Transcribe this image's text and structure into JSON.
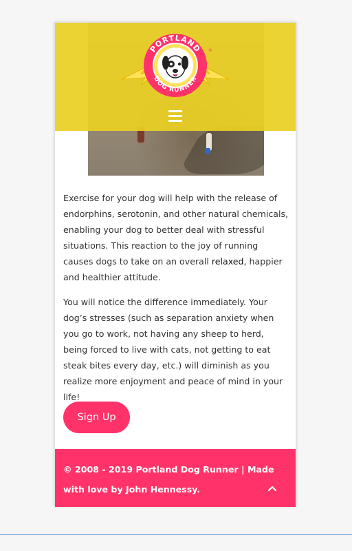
{
  "brand": {
    "logo_text_top": "PORTLAND",
    "logo_text_bottom": "DOG RUNNER",
    "registered_mark": "®",
    "colors": {
      "header_yellow": "#EAD024",
      "logo_pink": "#FF336A",
      "accent_pink": "#FF336A"
    }
  },
  "nav": {
    "menu_icon": "hamburger-menu-icon"
  },
  "main": {
    "paragraph1_before": "Exercise for your dog will help with the release of endorphins, serotonin, and other natural chemicals, enabling your dog to better deal with stressful situations. This reaction to the joy of running causes dogs to take on an overall ",
    "paragraph1_link": "relaxed",
    "paragraph1_after": ", happier and healthier attitude.",
    "paragraph2": "You will notice the difference immediately. Your dog’s stresses (such as separation anxiety when you go to work, not having any sheep to herd, being forced to live with cats, not getting to eat steak bites every day, etc.) will diminish as you realize more enjoyment and peace of mind in your life!",
    "signup_label": "Sign Up"
  },
  "footer": {
    "copyright": "© 2008 - 2019 Portland Dog Runner | Made with love by John Hennessy.",
    "scroll_top_icon": "chevron-up-icon"
  }
}
